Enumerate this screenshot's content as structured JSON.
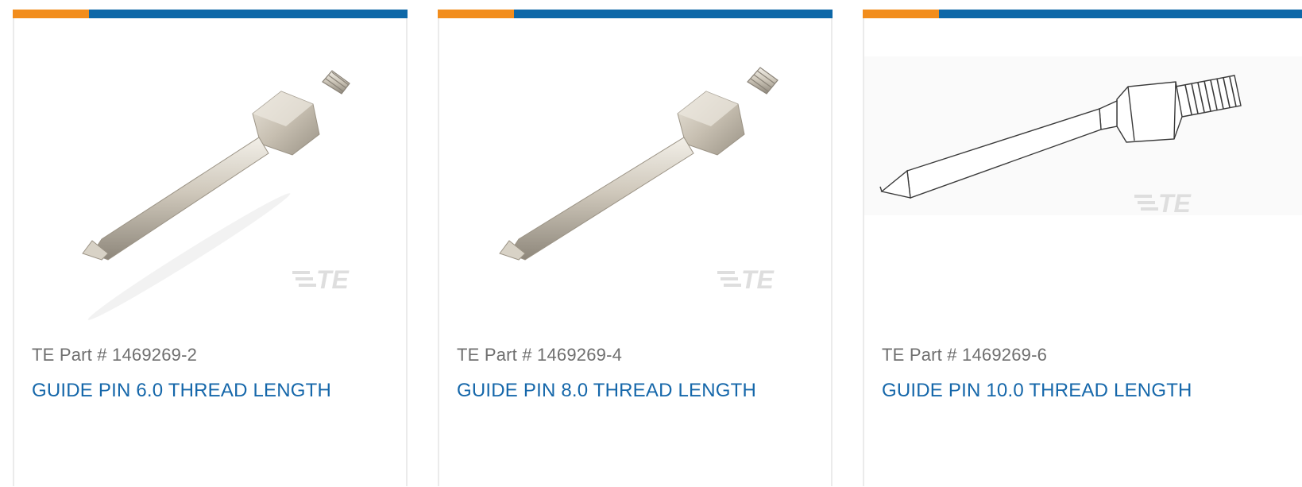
{
  "colors": {
    "accent_orange": "#f28d1c",
    "accent_blue": "#0e68a8",
    "link_blue": "#1567aa",
    "part_gray": "#6f6f6f"
  },
  "cards": [
    {
      "image_icon": "guide-pin-render-icon",
      "watermark": "TE",
      "part_number": "TE Part # 1469269-2",
      "title": "GUIDE PIN 6.0 THREAD LENGTH"
    },
    {
      "image_icon": "guide-pin-render-icon",
      "watermark": "TE",
      "part_number": "TE Part # 1469269-4",
      "title": "GUIDE PIN 8.0 THREAD LENGTH"
    },
    {
      "image_icon": "guide-pin-line-drawing-icon",
      "watermark": "TE",
      "part_number": "TE Part # 1469269-6",
      "title": "GUIDE PIN 10.0 THREAD LENGTH"
    }
  ]
}
